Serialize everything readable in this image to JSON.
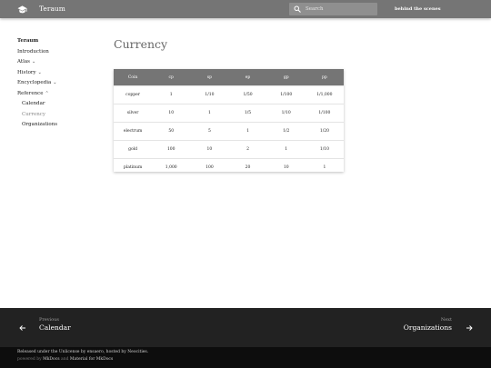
{
  "header": {
    "site_title": "Teraum",
    "search_placeholder": "Search",
    "link": "behind the scenes"
  },
  "nav": {
    "title": "Teraum",
    "items": [
      {
        "label": "Introduction"
      },
      {
        "label": "Atlas"
      },
      {
        "label": "History"
      },
      {
        "label": "Encyclopedia"
      },
      {
        "label": "Reference"
      }
    ],
    "reference_children": [
      {
        "label": "Calendar"
      },
      {
        "label": "Currency"
      },
      {
        "label": "Organizations"
      }
    ]
  },
  "page": {
    "title": "Currency"
  },
  "table": {
    "headers": [
      "Coin",
      "cp",
      "sp",
      "ep",
      "gp",
      "pp"
    ],
    "rows": [
      [
        "copper",
        "1",
        "1/10",
        "1/50",
        "1/100",
        "1/1,000"
      ],
      [
        "silver",
        "10",
        "1",
        "1/5",
        "1/10",
        "1/100"
      ],
      [
        "electrum",
        "50",
        "5",
        "1",
        "1/2",
        "1/20"
      ],
      [
        "gold",
        "100",
        "10",
        "2",
        "1",
        "1/10"
      ],
      [
        "platinum",
        "1,000",
        "100",
        "20",
        "10",
        "1"
      ]
    ]
  },
  "footer": {
    "prev_direction": "Previous",
    "prev_title": "Calendar",
    "next_direction": "Next",
    "next_title": "Organizations",
    "license": "Released under the Unlicense by ensaero, hosted by Neocities.",
    "powered_prefix": "powered by",
    "powered_link1": "MkDocs",
    "powered_and": "and",
    "powered_link2": "Material for MkDocs"
  },
  "colors": {
    "header_bg": "#757575",
    "footer_nav_bg": "#222222",
    "footer_meta_bg": "#0d0d0d"
  },
  "icons": {
    "logo": "book-icon",
    "search": "search-icon",
    "prev": "arrow-left-icon",
    "next": "arrow-right-icon",
    "expand": "chevron-down-icon",
    "collapse": "chevron-up-icon"
  }
}
